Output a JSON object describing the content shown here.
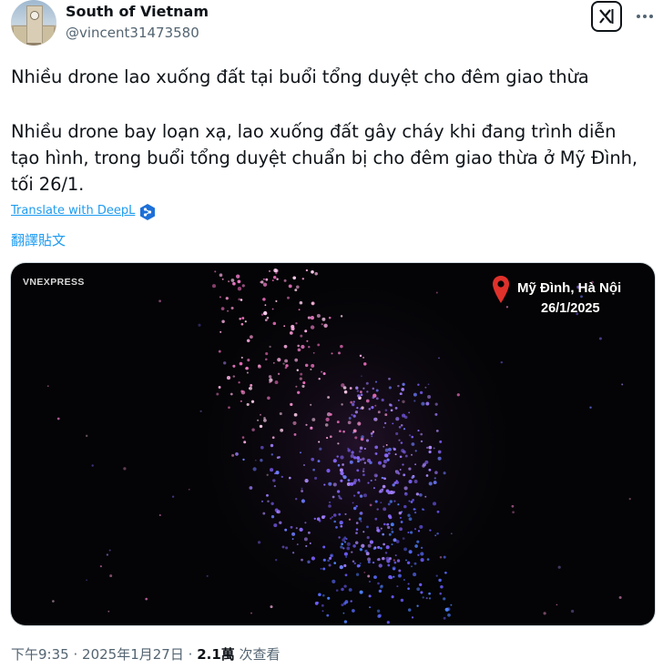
{
  "author": {
    "display_name": "South of Vietnam",
    "handle": "@vincent31473580",
    "avatar_icon": "avatar-photo"
  },
  "header_actions": {
    "grok_icon": "grok-icon",
    "more_icon": "more-icon"
  },
  "tweet": {
    "title_line": "Nhiều drone lao xuống đất tại buổi tổng duyệt cho đêm giao thừa",
    "body": "Nhiều drone bay loạn xạ, lao xuống đất gây cháy khi đang trình diễn tạo hình, trong buổi tổng duyệt chuẩn bị cho đêm giao thừa ở Mỹ Đình, tối 26/1."
  },
  "deepl": {
    "label": "Translate with DeepL",
    "icon": "deepl-icon"
  },
  "translate_label": "翻譯貼文",
  "media": {
    "brand": "VNEXPRESS",
    "location": "Mỹ Đình, Hà Nội",
    "date": "26/1/2025",
    "pin_icon": "location-pin-icon"
  },
  "meta": {
    "time": "下午9:35",
    "separator": "·",
    "date": "2025年1月27日",
    "views_count": "2.1萬",
    "views_label": "次查看"
  },
  "colors": {
    "link": "#1d9bf0",
    "secondary_text": "#536471",
    "primary_text": "#0f1419",
    "pin_red": "#e0312b"
  }
}
